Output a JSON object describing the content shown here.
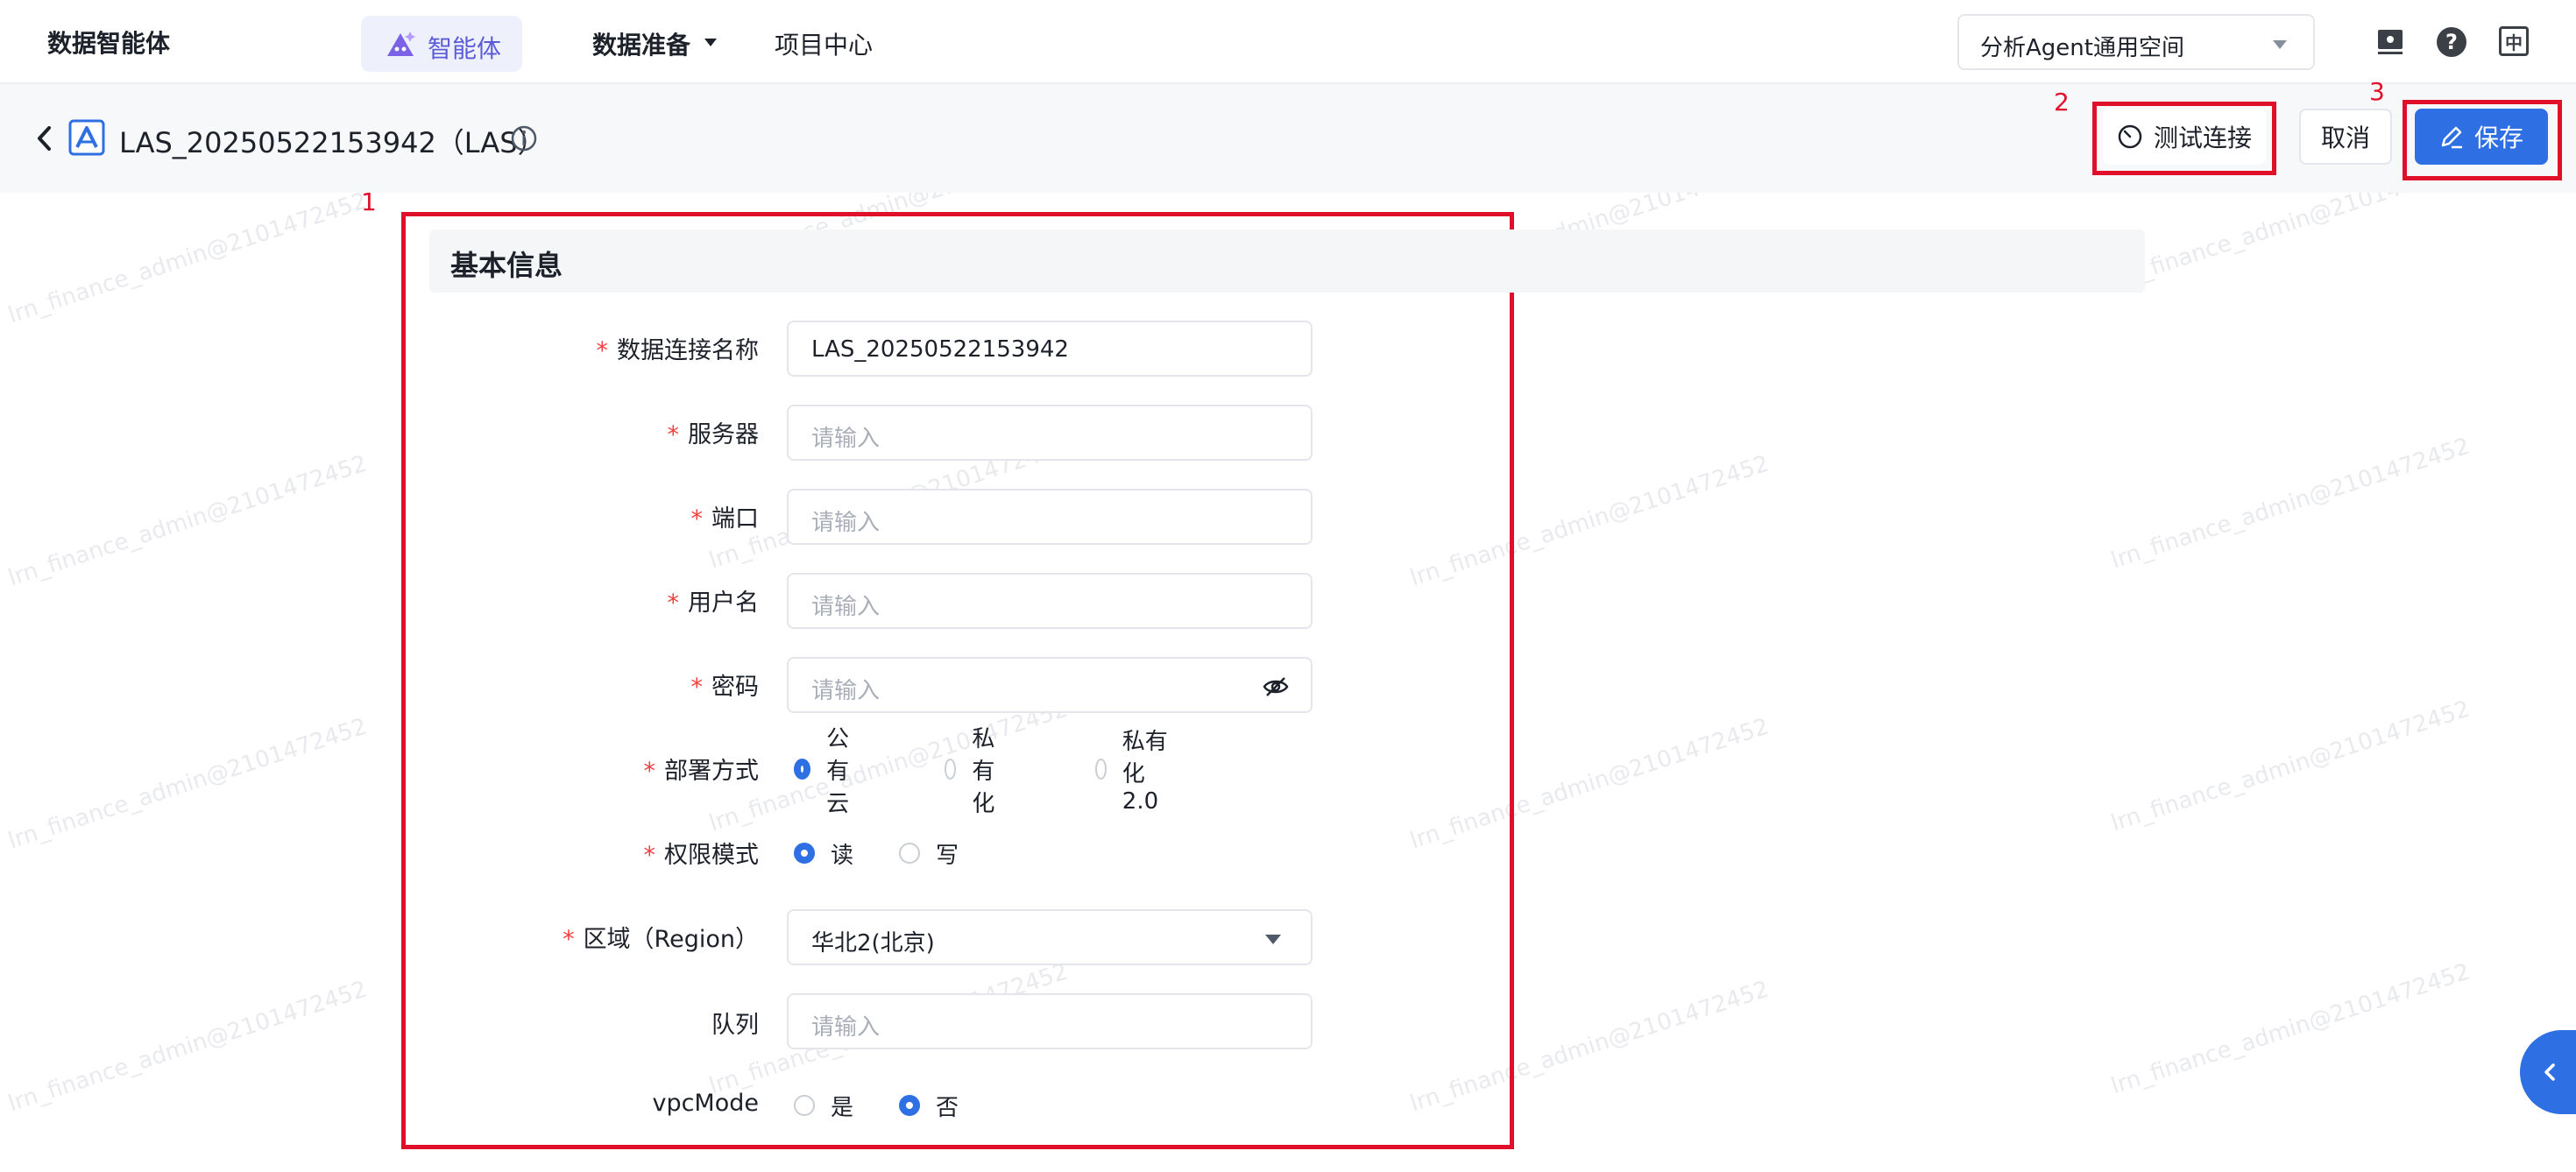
{
  "nav": {
    "brand": "数据智能体",
    "agent": "智能体",
    "data_prep": "数据准备",
    "project_center": "项目中心",
    "workspace": "分析Agent通用空间",
    "icons": [
      "monitor-icon",
      "help-icon",
      "language-icon"
    ],
    "lang_glyph": "中"
  },
  "header": {
    "title": "LAS_20250522153942（LAS）",
    "test_connection": "测试连接",
    "cancel": "取消",
    "save": "保存"
  },
  "markers": [
    "1",
    "2",
    "3"
  ],
  "section": {
    "title": "基本信息"
  },
  "form": {
    "connection_name": {
      "label": "数据连接名称",
      "value": "LAS_20250522153942"
    },
    "server": {
      "label": "服务器",
      "placeholder": "请输入"
    },
    "port": {
      "label": "端口",
      "placeholder": "请输入"
    },
    "username": {
      "label": "用户名",
      "placeholder": "请输入"
    },
    "password": {
      "label": "密码",
      "placeholder": "请输入"
    },
    "deployment": {
      "label": "部署方式",
      "options": [
        "公有云",
        "私有化",
        "私有化2.0"
      ],
      "selected": "公有云"
    },
    "permission": {
      "label": "权限模式",
      "options": [
        "读",
        "写"
      ],
      "selected": "读"
    },
    "region": {
      "label": "区域（Region）",
      "value": "华北2(北京)"
    },
    "queue": {
      "label": "队列",
      "placeholder": "请输入"
    },
    "vpc_mode": {
      "label": "vpcMode",
      "options": [
        "是",
        "否"
      ],
      "selected": "否"
    }
  },
  "watermark": "lrn_finance_admin@2101472452",
  "colors": {
    "primary": "#2f6fe4",
    "annotation": "#e0102a",
    "required": "#f53f3f",
    "agent_accent": "#5b5bd6"
  }
}
